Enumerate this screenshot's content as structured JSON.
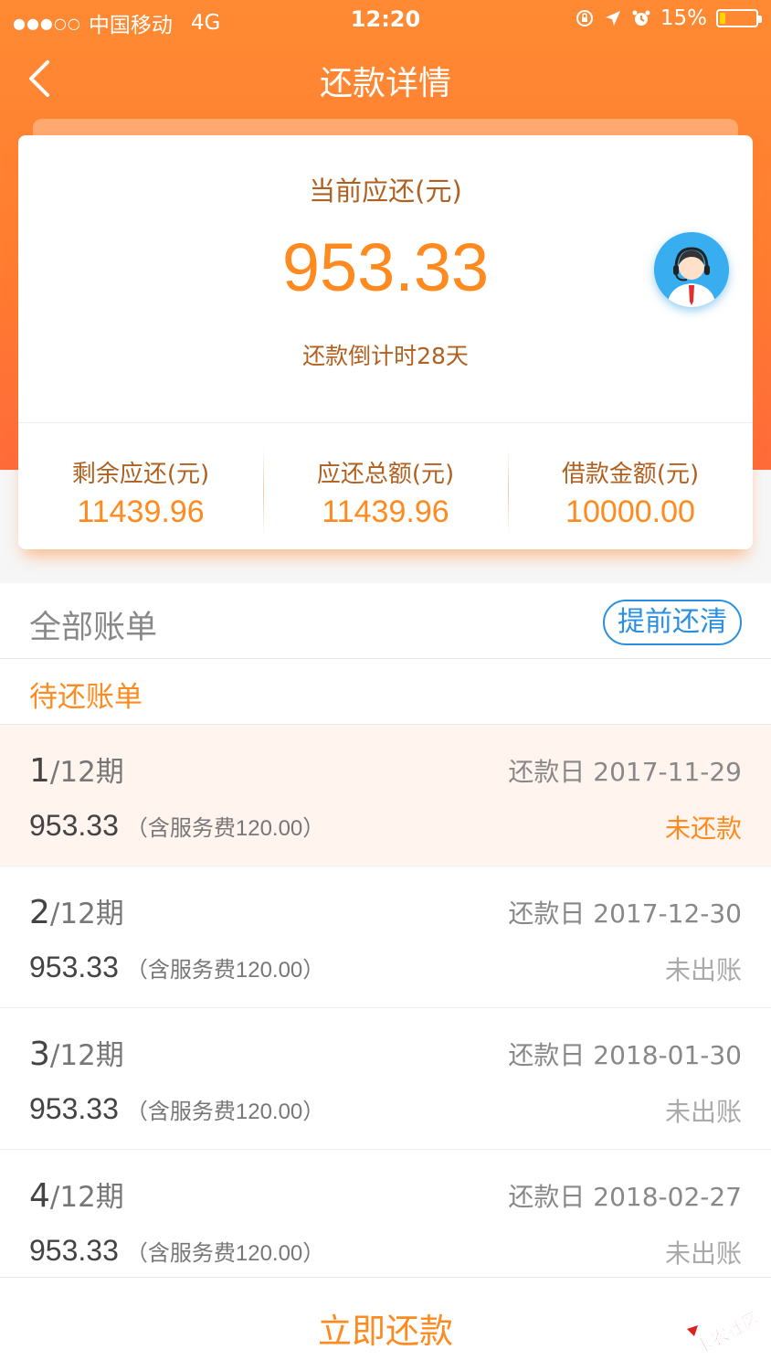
{
  "status_bar": {
    "signal": "●●●○○",
    "carrier": "中国移动",
    "network": "4G",
    "time": "12:20",
    "battery": "15%"
  },
  "nav": {
    "title": "还款详情"
  },
  "summary": {
    "current_label": "当前应还(元)",
    "current_amount": "953.33",
    "countdown": "还款倒计时28天",
    "stats": [
      {
        "label": "剩余应还(元)",
        "value": "11439.96"
      },
      {
        "label": "应还总额(元)",
        "value": "11439.96"
      },
      {
        "label": "借款金额(元)",
        "value": "10000.00"
      }
    ]
  },
  "bills": {
    "all_title": "全部账单",
    "payoff_button": "提前还清",
    "pending_title": "待还账单",
    "items": [
      {
        "period_num": "1",
        "period_total": "/12期",
        "date": "还款日 2017-11-29",
        "amount": "953.33",
        "fee": "（含服务费120.00）",
        "status": "未还款"
      },
      {
        "period_num": "2",
        "period_total": "/12期",
        "date": "还款日 2017-12-30",
        "amount": "953.33",
        "fee": "（含服务费120.00）",
        "status": "未出账"
      },
      {
        "period_num": "3",
        "period_total": "/12期",
        "date": "还款日 2018-01-30",
        "amount": "953.33",
        "fee": "（含服务费120.00）",
        "status": "未出账"
      },
      {
        "period_num": "4",
        "period_total": "/12期",
        "date": "还款日 2018-02-27",
        "amount": "953.33",
        "fee": "（含服务费120.00）",
        "status": "未出账"
      }
    ]
  },
  "bottom": {
    "pay_button": "立即还款"
  },
  "watermark": {
    "text": "卡农社区"
  },
  "colors": {
    "accent": "#ff8a1f",
    "header": "#ff7d30",
    "link": "#2a8fe0"
  }
}
